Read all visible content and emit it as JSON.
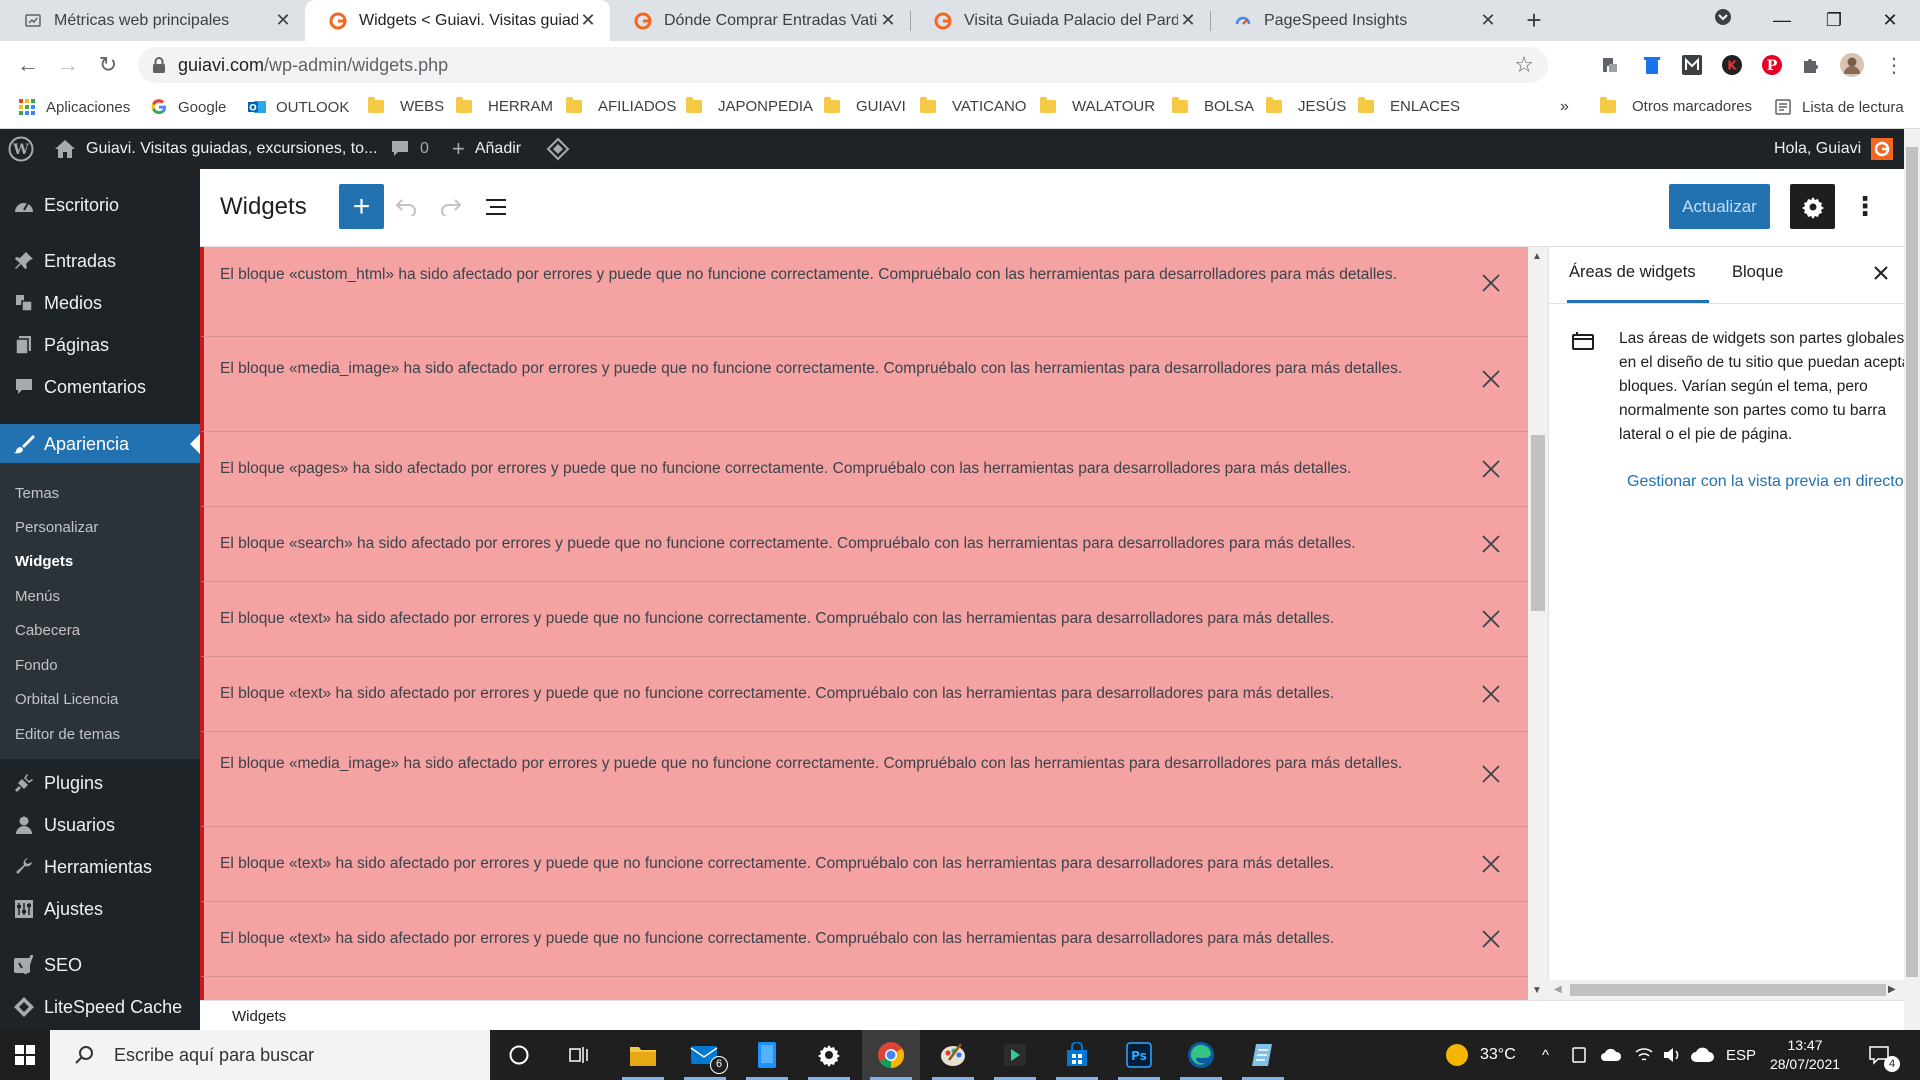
{
  "browser": {
    "tabs": [
      {
        "title": "Métricas web principales",
        "active": false
      },
      {
        "title": "Widgets < Guiavi. Visitas guiadas",
        "active": true
      },
      {
        "title": "Dónde Comprar Entradas Vaticano",
        "active": false
      },
      {
        "title": "Visita Guiada Palacio del Pardo",
        "active": false
      },
      {
        "title": "PageSpeed Insights",
        "active": false
      }
    ],
    "new_tab": "+",
    "url_host": "guiavi.com",
    "url_path": "/wp-admin/widgets.php",
    "bookmarks": [
      "Aplicaciones",
      "Google",
      "OUTLOOK",
      "WEBS",
      "HERRAM",
      "AFILIADOS",
      "JAPONPEDIA",
      "GUIAVI",
      "VATICANO",
      "WALATOUR",
      "BOLSA",
      "JESÚS",
      "ENLACES"
    ],
    "bookmarks_overflow": "»",
    "other_bookmarks": "Otros marcadores",
    "reading_list": "Lista de lectura"
  },
  "adminbar": {
    "site_name": "Guiavi. Visitas guiadas, excursiones, to...",
    "comments_count": "0",
    "add_new": "Añadir",
    "greeting": "Hola, Guiavi"
  },
  "sidebar": {
    "items": [
      {
        "label": "Escritorio",
        "icon": "dashboard-icon"
      },
      {
        "label": "Entradas",
        "icon": "pin-icon"
      },
      {
        "label": "Medios",
        "icon": "media-icon"
      },
      {
        "label": "Páginas",
        "icon": "page-icon"
      },
      {
        "label": "Comentarios",
        "icon": "comment-icon"
      },
      {
        "label": "Apariencia",
        "icon": "brush-icon"
      },
      {
        "label": "Plugins",
        "icon": "plugin-icon"
      },
      {
        "label": "Usuarios",
        "icon": "users-icon"
      },
      {
        "label": "Herramientas",
        "icon": "wrench-icon"
      },
      {
        "label": "Ajustes",
        "icon": "settings-icon"
      },
      {
        "label": "SEO",
        "icon": "seo-icon"
      },
      {
        "label": "LiteSpeed Cache",
        "icon": "diamond-icon"
      }
    ],
    "current": "Apariencia",
    "submenu": [
      "Temas",
      "Personalizar",
      "Widgets",
      "Menús",
      "Cabecera",
      "Fondo",
      "Orbital Licencia",
      "Editor de temas"
    ],
    "submenu_current": "Widgets"
  },
  "editor": {
    "title": "Widgets",
    "update_button": "Actualizar",
    "footer_breadcrumb": "Widgets"
  },
  "notices": [
    "El bloque «custom_html» ha sido afectado por errores y puede que no funcione correctamente. Compruébalo con las herramientas para desarrolladores para más detalles.",
    "El bloque «media_image» ha sido afectado por errores y puede que no funcione correctamente. Compruébalo con las herramientas para desarrolladores para más detalles.",
    "El bloque «pages» ha sido afectado por errores y puede que no funcione correctamente. Compruébalo con las herramientas para desarrolladores para más detalles.",
    "El bloque «search» ha sido afectado por errores y puede que no funcione correctamente. Compruébalo con las herramientas para desarrolladores para más detalles.",
    "El bloque «text» ha sido afectado por errores y puede que no funcione correctamente. Compruébalo con las herramientas para desarrolladores para más detalles.",
    "El bloque «text» ha sido afectado por errores y puede que no funcione correctamente. Compruébalo con las herramientas para desarrolladores para más detalles.",
    "El bloque «media_image» ha sido afectado por errores y puede que no funcione correctamente. Compruébalo con las herramientas para desarrolladores para más detalles.",
    "El bloque «text» ha sido afectado por errores y puede que no funcione correctamente. Compruébalo con las herramientas para desarrolladores para más detalles.",
    "El bloque «text» ha sido afectado por errores y puede que no funcione correctamente. Compruébalo con las herramientas para desarrolladores para más detalles."
  ],
  "panel": {
    "tab_widget_areas": "Áreas de widgets",
    "tab_block": "Bloque",
    "description": "Las áreas de widgets son partes globales en el diseño de tu sitio que puedan aceptar bloques. Varían según el tema, pero normalmente son partes como tu barra lateral o el pie de página.",
    "link": "Gestionar con la vista previa en directo"
  },
  "taskbar": {
    "search_placeholder": "Escribe aquí para buscar",
    "mail_badge": "6",
    "temperature": "33°C",
    "language": "ESP",
    "time": "13:47",
    "date": "28/07/2021",
    "notifications": "4"
  },
  "colors": {
    "wp_blue": "#2271b1",
    "notice_bg": "#f4a2a2",
    "notice_border": "#cc1818",
    "admin_dark": "#1d2327"
  }
}
